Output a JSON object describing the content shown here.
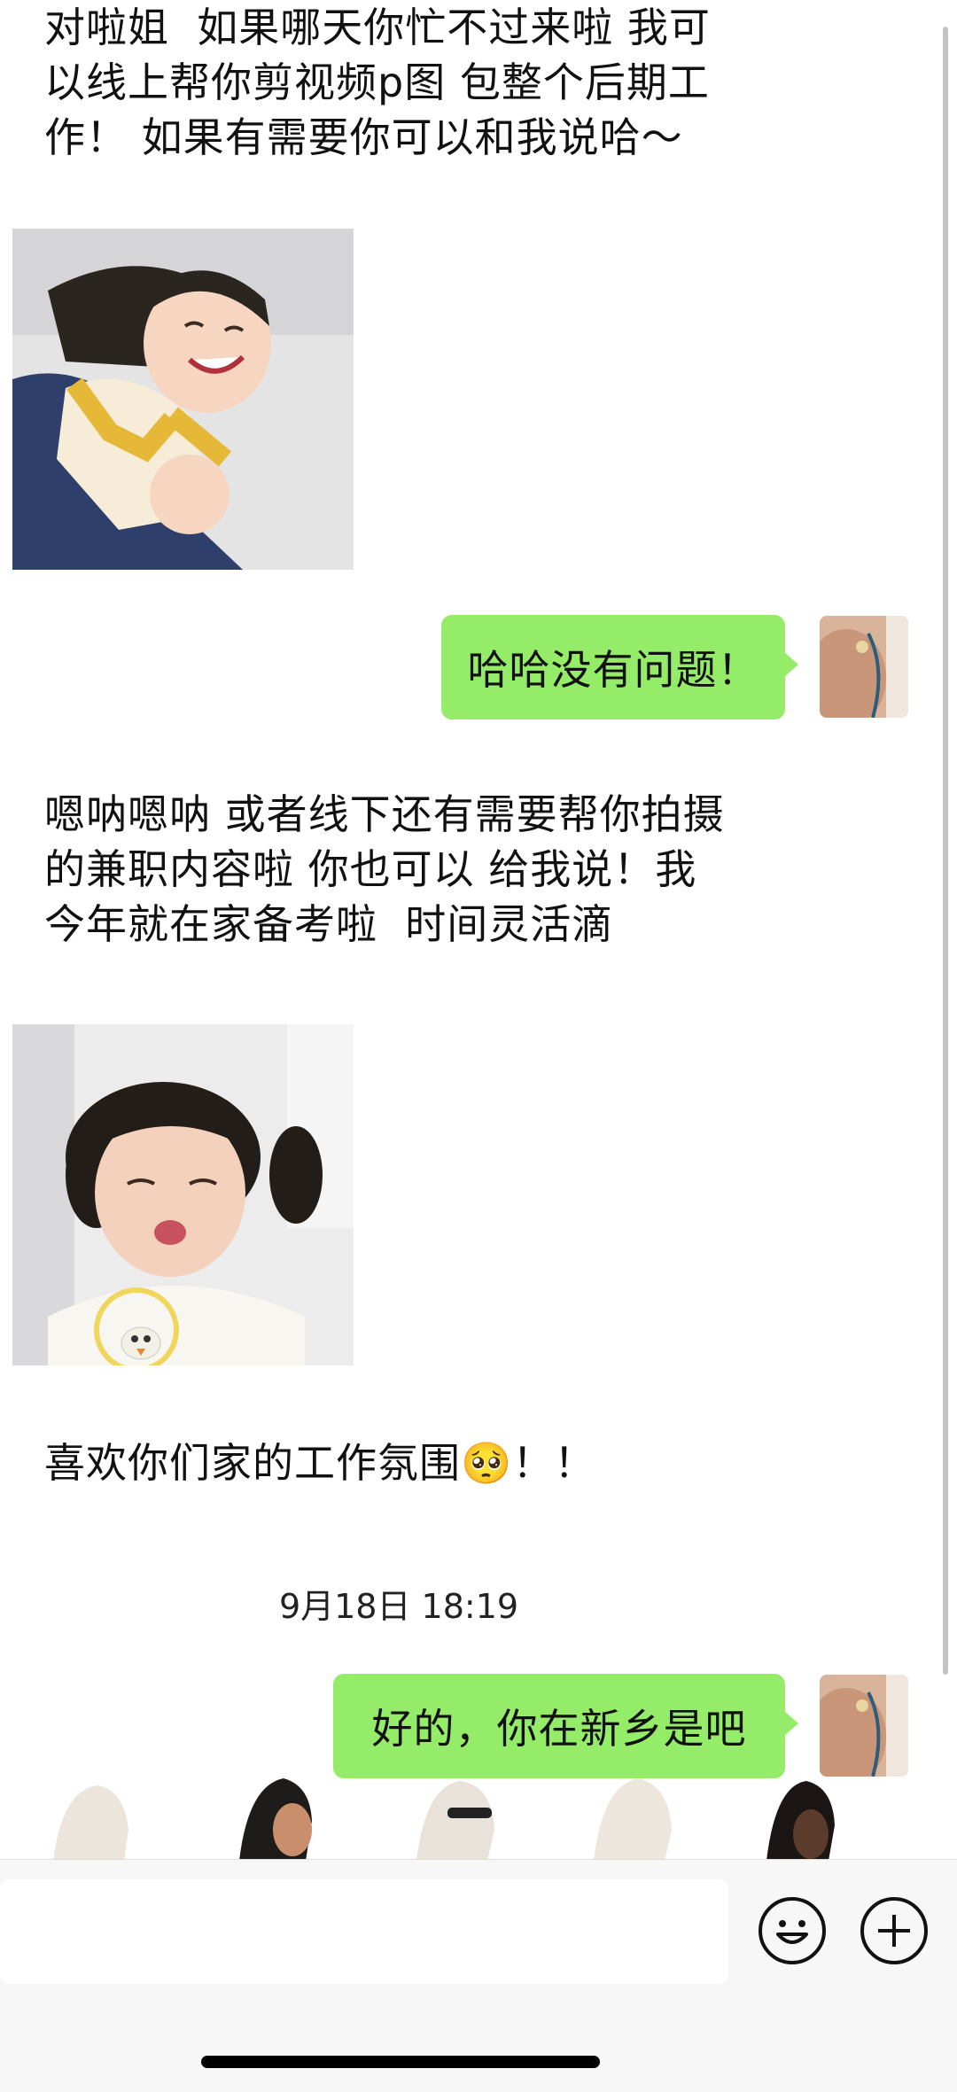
{
  "messages": {
    "m1": "对啦姐  如果哪天你忙不过来啦 我可\n以线上帮你剪视频p图 包整个后期工\n作！ 如果有需要你可以和我说哈～",
    "m2_bubble": "哈哈没有问题！",
    "m3": "嗯呐嗯呐 或者线下还有需要帮你拍摄\n的兼职内容啦 你也可以 给我说！我\n今年就在家备考啦  时间灵活滴",
    "m4_text": "喜欢你们家的工作氛围",
    "m4_emoji": "🥺",
    "m4_suffix": "！！",
    "timestamp": "9月18日 18:19",
    "m5_bubble": "好的，你在新乡是吧"
  },
  "stickers": {
    "sticker1": "smiling-girl-sticker",
    "sticker2": "pouting-girl-sticker"
  },
  "input_bar": {
    "input_value": "",
    "emoji_button": "smiley-face-icon",
    "more_button": "plus-icon"
  },
  "colors": {
    "bubble_sent": "#95ec69",
    "background": "#ffffff",
    "input_bar": "#f7f7f7"
  }
}
